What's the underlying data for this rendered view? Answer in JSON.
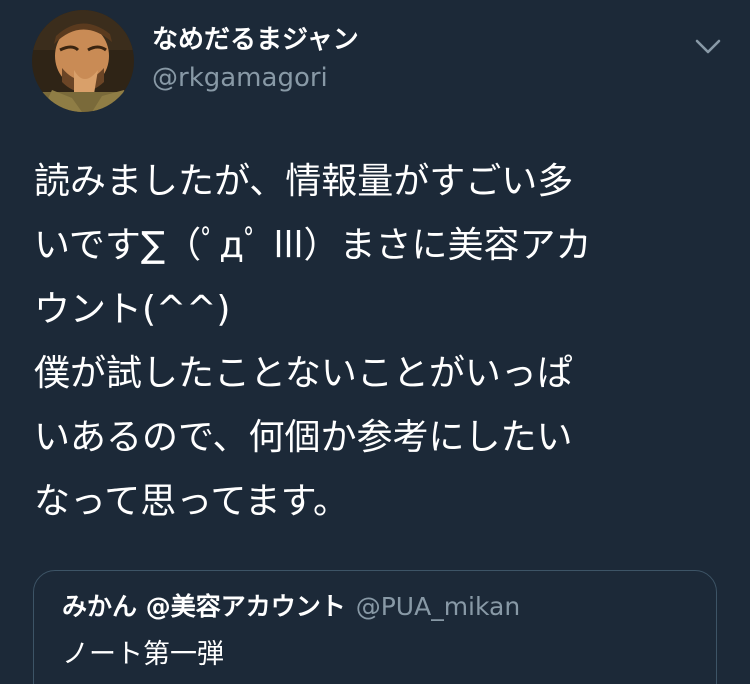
{
  "tweet": {
    "author": {
      "display_name": "なめだるまジャン",
      "handle": "@rkgamagori",
      "avatar_icon": "user-avatar"
    },
    "menu_icon": "chevron-down-icon",
    "body_lines": [
      "読みましたが、情報量がすごい多",
      "いです∑（ﾟдﾟ lll）まさに美容アカ",
      "ウント(^^)",
      "僕が試したことないことがいっぱ",
      "いあるので、何個か参考にしたい",
      "なって思ってます。"
    ],
    "quoted": {
      "display_name": "みかん @美容アカウント",
      "handle": "@PUA_mikan",
      "text": "ノート第一弾"
    }
  },
  "colors": {
    "background": "#1c2938",
    "primary_text": "#ffffff",
    "secondary_text": "#8899a6",
    "card_border": "#3d5466"
  }
}
